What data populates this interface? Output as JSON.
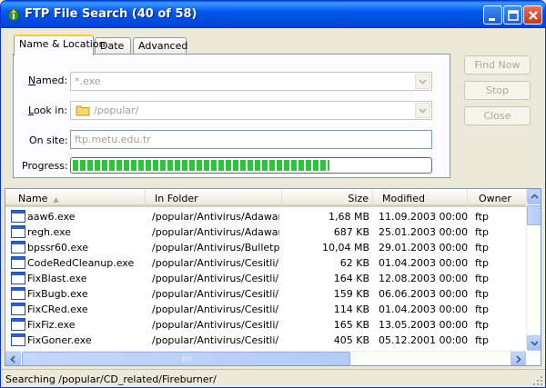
{
  "window": {
    "title": "FTP File Search (40 of 58)"
  },
  "tabs": [
    {
      "label": "Name & Location",
      "active": true
    },
    {
      "label": "Date",
      "active": false
    },
    {
      "label": "Advanced",
      "active": false
    }
  ],
  "form": {
    "named_label": "Named:",
    "named_value": "*.exe",
    "lookin_label": "Look in:",
    "lookin_value": "/popular/",
    "onsite_label": "On site:",
    "onsite_value": "ftp.metu.edu.tr",
    "progress_label": "Progress:",
    "progress_fraction": 0.72
  },
  "buttons": {
    "find_now": "Find Now",
    "stop": "Stop",
    "close": "Close"
  },
  "columns": [
    "Name",
    "In Folder",
    "Size",
    "Modified",
    "Owner"
  ],
  "rows": [
    {
      "name": "aaw6.exe",
      "folder": "/popular/Antivirus/Adaware/",
      "size": "1,68 MB",
      "modified": "11.09.2003 00:00",
      "owner": "ftp"
    },
    {
      "name": "regh.exe",
      "folder": "/popular/Antivirus/Adaware/",
      "size": "687 KB",
      "modified": "25.01.2003 00:00",
      "owner": "ftp"
    },
    {
      "name": "bpssr60.exe",
      "folder": "/popular/Antivirus/Bulletpr...",
      "size": "10,04 MB",
      "modified": "29.01.2003 00:00",
      "owner": "ftp"
    },
    {
      "name": "CodeRedCleanup.exe",
      "folder": "/popular/Antivirus/Cesitli/",
      "size": "62 KB",
      "modified": "01.04.2003 00:00",
      "owner": "ftp"
    },
    {
      "name": "FixBlast.exe",
      "folder": "/popular/Antivirus/Cesitli/",
      "size": "164 KB",
      "modified": "12.08.2003 00:00",
      "owner": "ftp"
    },
    {
      "name": "FixBugb.exe",
      "folder": "/popular/Antivirus/Cesitli/",
      "size": "159 KB",
      "modified": "06.06.2003 00:00",
      "owner": "ftp"
    },
    {
      "name": "FixCRed.exe",
      "folder": "/popular/Antivirus/Cesitli/",
      "size": "114 KB",
      "modified": "01.04.2003 00:00",
      "owner": "ftp"
    },
    {
      "name": "FixFiz.exe",
      "folder": "/popular/Antivirus/Cesitli/",
      "size": "165 KB",
      "modified": "13.05.2003 00:00",
      "owner": "ftp"
    },
    {
      "name": "FixGoner.exe",
      "folder": "/popular/Antivirus/Cesitli/",
      "size": "405 KB",
      "modified": "05.12.2001 00:00",
      "owner": "ftp"
    }
  ],
  "status": {
    "text": "Searching /popular/CD_related/Fireburner/"
  },
  "colors": {
    "titlebar": "#0058ee",
    "progress_fill": "#29c53a",
    "list_border": "#7f9db9"
  }
}
